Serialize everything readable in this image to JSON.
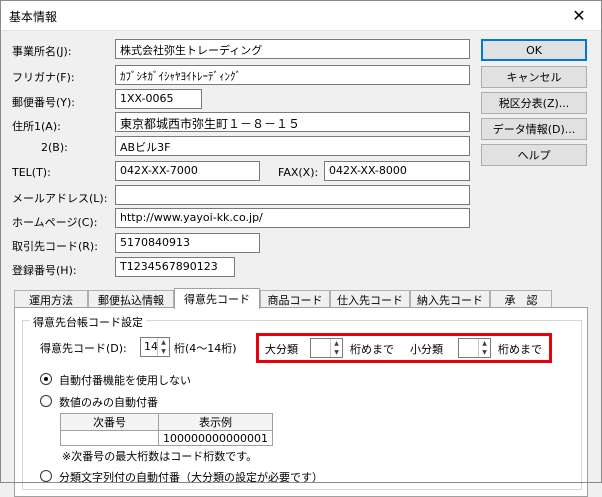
{
  "window": {
    "title": "基本情報",
    "close_glyph": "✕"
  },
  "form": {
    "company_name": {
      "label": "事業所名(J):",
      "value": "株式会社弥生トレーディング"
    },
    "furigana": {
      "label": "フリガナ(F):",
      "value": "ｶﾌﾞｼｷｶﾞｲｼｬﾔﾖｲﾄﾚｰﾃﾞｨﾝｸﾞ"
    },
    "postal": {
      "label": "郵便番号(Y):",
      "value": "1XX-0065"
    },
    "address1": {
      "label": "住所1(A):",
      "value": "東京都城西市弥生町１－８－１５"
    },
    "address2": {
      "label": "2(B):",
      "value": "ABビル3F"
    },
    "tel": {
      "label": "TEL(T):",
      "value": "042X-XX-7000"
    },
    "fax": {
      "label": "FAX(X):",
      "value": "042X-XX-8000"
    },
    "email": {
      "label": "メールアドレス(L):",
      "value": ""
    },
    "homepage": {
      "label": "ホームページ(C):",
      "value": "http://www.yayoi-kk.co.jp/"
    },
    "partner_code": {
      "label": "取引先コード(R):",
      "value": "5170840913"
    },
    "registration": {
      "label": "登録番号(H):",
      "value": "T1234567890123"
    }
  },
  "buttons": {
    "ok": "OK",
    "cancel": "キャンセル",
    "tax": "税区分表(Z)...",
    "data_info": "データ情報(D)...",
    "help": "ヘルプ"
  },
  "tabs": [
    "運用方法",
    "郵便払込情報",
    "得意先コード",
    "商品コード",
    "仕入先コード",
    "納入先コード",
    "承　認"
  ],
  "active_tab": "得意先コード",
  "panel": {
    "group_title": "得意先台帳コード設定",
    "code_label": "得意先コード(D):",
    "code_digits": "14",
    "digits_suffix": "桁(4～14桁)",
    "major_label": "大分類",
    "major_value": "",
    "major_suffix": "桁めまで",
    "minor_label": "小分類",
    "minor_value": "",
    "minor_suffix": "桁めまで",
    "radio1": "自動付番機能を使用しない",
    "radio2": "数値のみの自動付番",
    "table_headers": [
      "次番号",
      "表示例"
    ],
    "table_values": [
      "",
      "100000000000001"
    ],
    "note": "※次番号の最大桁数はコード桁数です。",
    "radio3": "分類文字列付の自動付番（大分類の設定が必要です）"
  },
  "colors": {
    "highlight": "#e8000b",
    "default_button_border": "#0078d7"
  }
}
